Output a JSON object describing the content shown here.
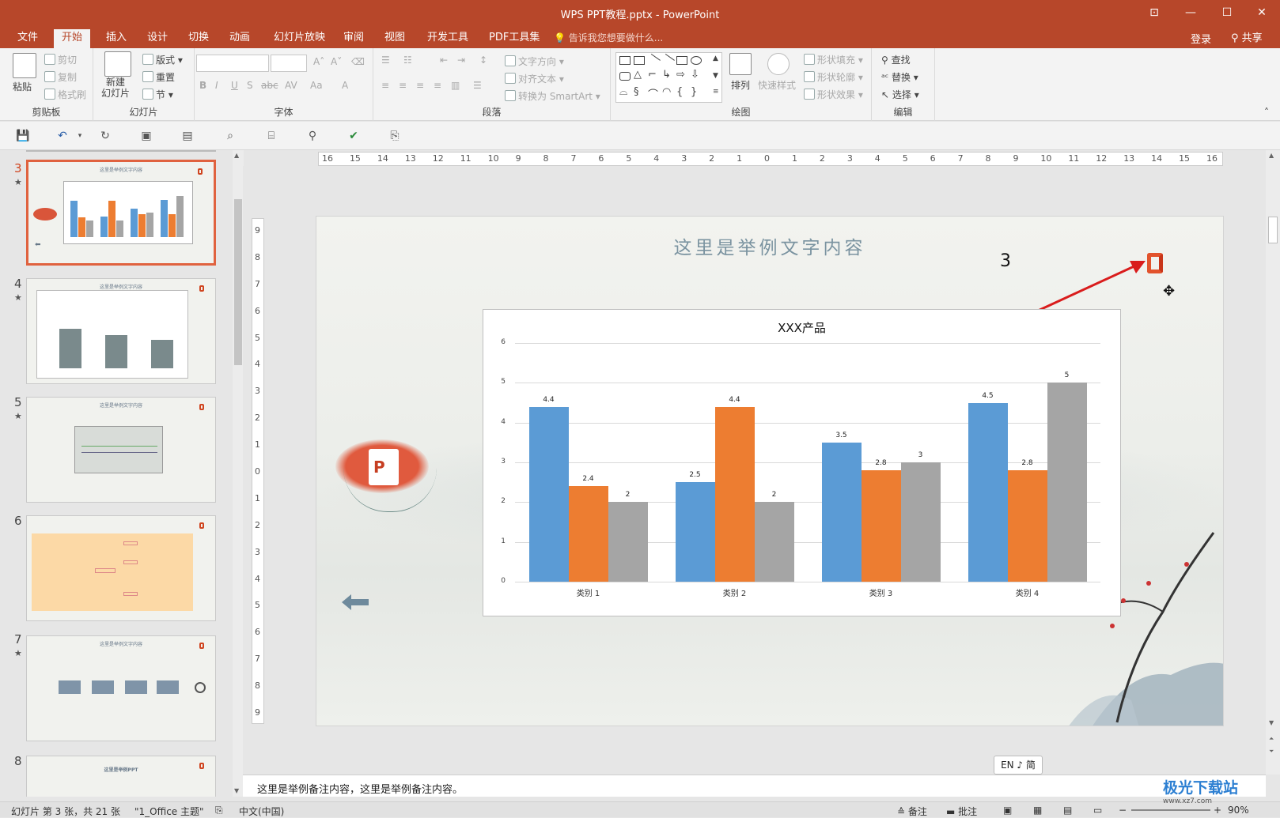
{
  "window": {
    "title": "WPS PPT教程.pptx - PowerPoint"
  },
  "menu": {
    "tabs": [
      "文件",
      "开始",
      "插入",
      "设计",
      "切换",
      "动画",
      "幻灯片放映",
      "审阅",
      "视图",
      "开发工具",
      "PDF工具集"
    ],
    "active_tab": "开始",
    "tell_me": "告诉我您想要做什么...",
    "login": "登录",
    "share": "共享"
  },
  "ribbon": {
    "clipboard": {
      "paste": "粘贴",
      "cut": "剪切",
      "copy": "复制",
      "format_painter": "格式刷",
      "label": "剪贴板"
    },
    "slides": {
      "new_slide": "新建\n幻灯片",
      "layout": "版式",
      "reset": "重置",
      "section": "节",
      "label": "幻灯片"
    },
    "font": {
      "label": "字体"
    },
    "paragraph": {
      "text_direction": "文字方向",
      "align_text": "对齐文本",
      "convert_smartart": "转换为 SmartArt",
      "label": "段落"
    },
    "drawing": {
      "arrange": "排列",
      "quick_styles": "快速样式",
      "shape_fill": "形状填充",
      "shape_outline": "形状轮廓",
      "shape_effects": "形状效果",
      "label": "绘图"
    },
    "editing": {
      "find": "查找",
      "replace": "替换",
      "select": "选择",
      "label": "编辑"
    }
  },
  "rulers": {
    "horizontal": [
      "16",
      "15",
      "14",
      "13",
      "12",
      "11",
      "10",
      "9",
      "8",
      "7",
      "6",
      "5",
      "4",
      "3",
      "2",
      "1",
      "0",
      "1",
      "2",
      "3",
      "4",
      "5",
      "6",
      "7",
      "8",
      "9",
      "10",
      "11",
      "12",
      "13",
      "14",
      "15",
      "16"
    ],
    "vertical": [
      "9",
      "8",
      "7",
      "6",
      "5",
      "4",
      "3",
      "2",
      "1",
      "0",
      "1",
      "2",
      "3",
      "4",
      "5",
      "6",
      "7",
      "8",
      "9"
    ]
  },
  "thumbnails": [
    {
      "num": "3",
      "title": "这里是举例文字内容",
      "selected": true
    },
    {
      "num": "4",
      "title": "这里是举例文字内容",
      "selected": false
    },
    {
      "num": "5",
      "title": "这里是举例文字内容",
      "selected": false
    },
    {
      "num": "6",
      "title": "",
      "selected": false
    },
    {
      "num": "7",
      "title": "这里是举例文字内容",
      "selected": false
    },
    {
      "num": "8",
      "title": "这里是举例PPT",
      "selected": false
    }
  ],
  "slide": {
    "title": "这里是举例文字内容",
    "number": "3",
    "footer_number": "3"
  },
  "chart_data": {
    "type": "bar",
    "title": "XXX产品",
    "categories": [
      "类别 1",
      "类别 2",
      "类别 3",
      "类别 4"
    ],
    "series": [
      {
        "values": [
          4.4,
          2.5,
          3.5,
          4.5
        ],
        "color": "#5b9bd5"
      },
      {
        "values": [
          2.4,
          4.4,
          2.8,
          2.8
        ],
        "color": "#ed7d31"
      },
      {
        "values": [
          2,
          2,
          3,
          5
        ],
        "color": "#a5a5a5"
      }
    ],
    "ylim": [
      0,
      6
    ],
    "yticks": [
      "0",
      "1",
      "2",
      "3",
      "4",
      "5",
      "6"
    ],
    "grid": true
  },
  "notes": "这里是举例备注内容，这里是举例备注内容。",
  "ime": "EN ♪ 简",
  "status": {
    "slide_info": "幻灯片 第 3 张，共 21 张",
    "theme": "\"1_Office 主题\"",
    "language": "中文(中国)",
    "notes_btn": "备注",
    "comments_btn": "批注",
    "zoom": "90%"
  },
  "watermark": {
    "main": "极光下载站",
    "sub": "www.xz7.com"
  },
  "colors": {
    "brand": "#b7472a",
    "selection": "#e0623f"
  }
}
